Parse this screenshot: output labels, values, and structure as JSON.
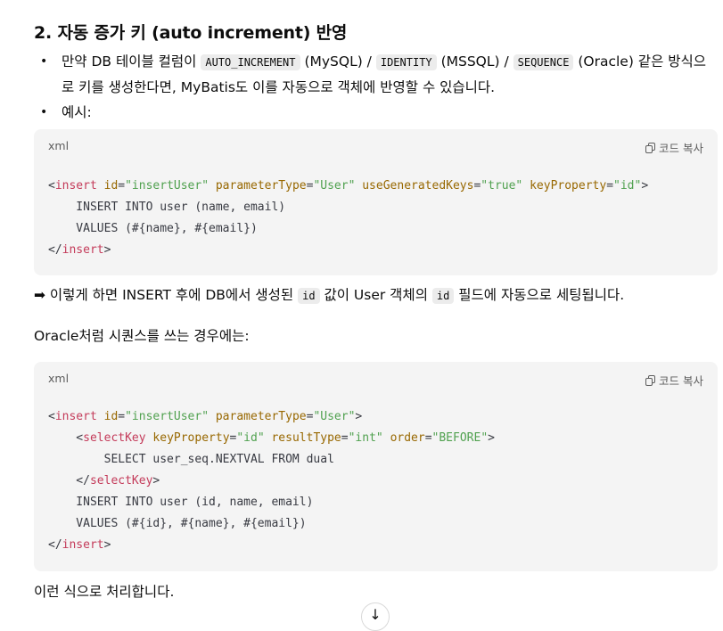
{
  "heading": "2. 자동 증가 키 (auto increment) 반영",
  "bullets": [
    {
      "pre": "만약 DB 테이블 컬럼이 ",
      "code1": "AUTO_INCREMENT",
      "mid1": " (MySQL) / ",
      "code2": "IDENTITY",
      "mid2": " (MSSQL) / ",
      "code3": "SEQUENCE",
      "post": " (Oracle) 같은 방식으로 키를 생성한다면, MyBatis도 이를 자동으로 객체에 반영할 수 있습니다."
    },
    {
      "text": "예시:"
    }
  ],
  "code_block_1": {
    "lang": "xml",
    "copy_label": "코드 복사",
    "lines": [
      "<insert id=\"insertUser\" parameterType=\"User\" useGeneratedKeys=\"true\" keyProperty=\"id\">",
      "    INSERT INTO user (name, email)",
      "    VALUES (#{name}, #{email})",
      "</insert>"
    ]
  },
  "result_note": {
    "arrow": "➡",
    "pre": " 이렇게 하면 INSERT 후에 DB에서 생성된 ",
    "code1": "id",
    "mid": " 값이 User 객체의 ",
    "code2": "id",
    "post": " 필드에 자동으로 세팅됩니다."
  },
  "oracle_intro": "Oracle처럼 시퀀스를 쓰는 경우에는:",
  "code_block_2": {
    "lang": "xml",
    "copy_label": "코드 복사",
    "lines": [
      "<insert id=\"insertUser\" parameterType=\"User\">",
      "    <selectKey keyProperty=\"id\" resultType=\"int\" order=\"BEFORE\">",
      "        SELECT user_seq.NEXTVAL FROM dual",
      "    </selectKey>",
      "    INSERT INTO user (id, name, email)",
      "    VALUES (#{id}, #{name}, #{email})",
      "</insert>"
    ]
  },
  "closing": "이런 식으로 처리합니다.",
  "scroll_down_icon": "arrow-down-icon",
  "colors": {
    "tag": "#c43b5a",
    "attr": "#986801",
    "value": "#50a14f",
    "code_bg": "#f4f4f4"
  }
}
